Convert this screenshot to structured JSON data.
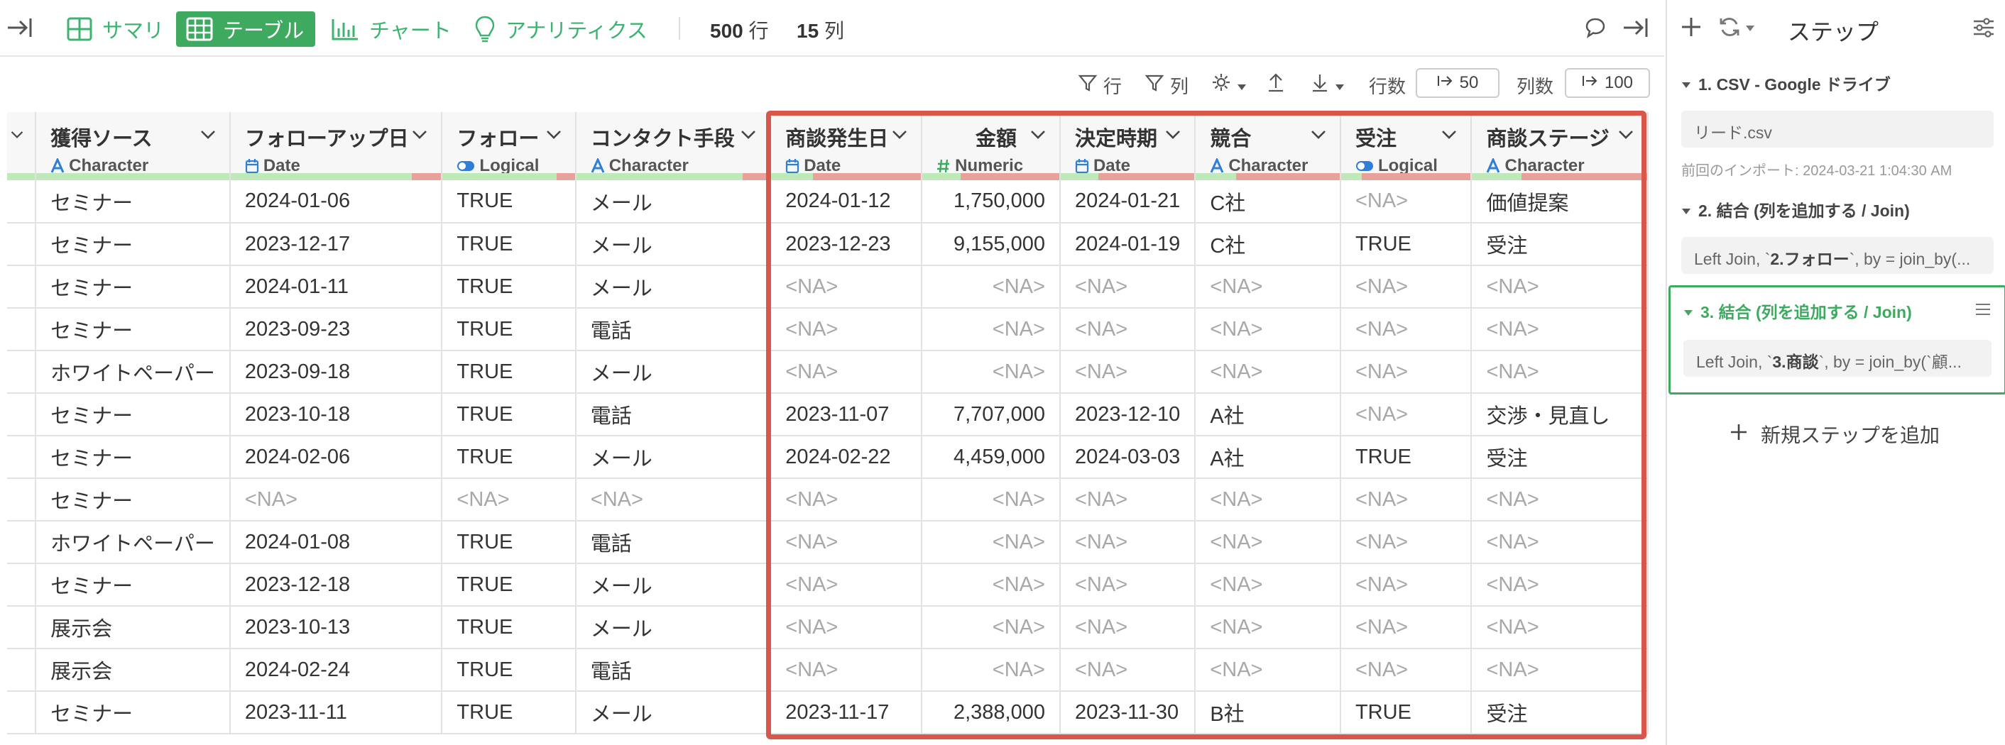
{
  "toolbar": {
    "tabs": [
      {
        "label": "サマリ",
        "icon": "summary-grid-icon"
      },
      {
        "label": "テーブル",
        "icon": "table-icon",
        "active": true
      },
      {
        "label": "チャート",
        "icon": "bar-chart-icon"
      },
      {
        "label": "アナリティクス",
        "icon": "lightbulb-icon"
      }
    ],
    "rows_count": "500",
    "rows_unit": "行",
    "cols_count": "15",
    "cols_unit": "列"
  },
  "toolbar2": {
    "filter_rows": "行",
    "filter_cols": "列",
    "row_count_label": "行数",
    "row_count_value": "50",
    "col_count_label": "列数",
    "col_count_value": "100"
  },
  "columns": [
    {
      "name": "獲得ソース",
      "type": "Character",
      "type_icon": "character-icon",
      "ok": 1.0
    },
    {
      "name": "フォローアップ日",
      "type": "Date",
      "type_icon": "calendar-icon",
      "ok": 0.86
    },
    {
      "name": "フォロー",
      "type": "Logical",
      "type_icon": "toggle-icon",
      "ok": 0.86
    },
    {
      "name": "コンタクト手段",
      "type": "Character",
      "type_icon": "character-icon",
      "ok": 0.86
    },
    {
      "name": "商談発生日",
      "type": "Date",
      "type_icon": "calendar-icon",
      "ok": 0.28
    },
    {
      "name": "金額",
      "type": "Numeric",
      "type_icon": "numeric-icon",
      "ok": 0.28
    },
    {
      "name": "決定時期",
      "type": "Date",
      "type_icon": "calendar-icon",
      "ok": 0.28
    },
    {
      "name": "競合",
      "type": "Character",
      "type_icon": "character-icon",
      "ok": 0.28
    },
    {
      "name": "受注",
      "type": "Logical",
      "type_icon": "toggle-icon",
      "ok": 0.16
    },
    {
      "name": "商談ステージ",
      "type": "Character",
      "type_icon": "character-icon",
      "ok": 0.28
    }
  ],
  "rows": [
    [
      "セミナー",
      "2024-01-06",
      "TRUE",
      "メール",
      "2024-01-12",
      "1,750,000",
      "2024-01-21",
      "C社",
      "<NA>",
      "価値提案"
    ],
    [
      "セミナー",
      "2023-12-17",
      "TRUE",
      "メール",
      "2023-12-23",
      "9,155,000",
      "2024-01-19",
      "C社",
      "TRUE",
      "受注"
    ],
    [
      "セミナー",
      "2024-01-11",
      "TRUE",
      "メール",
      "<NA>",
      "<NA>",
      "<NA>",
      "<NA>",
      "<NA>",
      "<NA>"
    ],
    [
      "セミナー",
      "2023-09-23",
      "TRUE",
      "電話",
      "<NA>",
      "<NA>",
      "<NA>",
      "<NA>",
      "<NA>",
      "<NA>"
    ],
    [
      "ホワイトペーパー",
      "2023-09-18",
      "TRUE",
      "メール",
      "<NA>",
      "<NA>",
      "<NA>",
      "<NA>",
      "<NA>",
      "<NA>"
    ],
    [
      "セミナー",
      "2023-10-18",
      "TRUE",
      "電話",
      "2023-11-07",
      "7,707,000",
      "2023-12-10",
      "A社",
      "<NA>",
      "交渉・見直し"
    ],
    [
      "セミナー",
      "2024-02-06",
      "TRUE",
      "メール",
      "2024-02-22",
      "4,459,000",
      "2024-03-03",
      "A社",
      "TRUE",
      "受注"
    ],
    [
      "セミナー",
      "<NA>",
      "<NA>",
      "<NA>",
      "<NA>",
      "<NA>",
      "<NA>",
      "<NA>",
      "<NA>",
      "<NA>"
    ],
    [
      "ホワイトペーパー",
      "2024-01-08",
      "TRUE",
      "電話",
      "<NA>",
      "<NA>",
      "<NA>",
      "<NA>",
      "<NA>",
      "<NA>"
    ],
    [
      "セミナー",
      "2023-12-18",
      "TRUE",
      "メール",
      "<NA>",
      "<NA>",
      "<NA>",
      "<NA>",
      "<NA>",
      "<NA>"
    ],
    [
      "展示会",
      "2023-10-13",
      "TRUE",
      "メール",
      "<NA>",
      "<NA>",
      "<NA>",
      "<NA>",
      "<NA>",
      "<NA>"
    ],
    [
      "展示会",
      "2024-02-24",
      "TRUE",
      "電話",
      "<NA>",
      "<NA>",
      "<NA>",
      "<NA>",
      "<NA>",
      "<NA>"
    ],
    [
      "セミナー",
      "2023-11-11",
      "TRUE",
      "メール",
      "2023-11-17",
      "2,388,000",
      "2023-11-30",
      "B社",
      "TRUE",
      "受注"
    ]
  ],
  "panel": {
    "title": "ステップ",
    "steps": [
      {
        "title": "1. CSV - Google ドライブ",
        "body": "リード.csv",
        "note": "前回のインポート: 2024-03-21 1:04:30 AM"
      },
      {
        "title": "2. 結合 (列を追加する / Join)",
        "body_prefix": "Left Join, `",
        "body_bold": "2.フォロー",
        "body_suffix": "`, by = join_by(..."
      },
      {
        "title": "3. 結合 (列を追加する / Join)",
        "body_prefix": "Left Join, `",
        "body_bold": "3.商談",
        "body_suffix": "`, by = join_by(`顧..."
      }
    ],
    "add_step": "新規ステップを追加"
  },
  "colors": {
    "accent": "#3eaa60",
    "highlight": "#d9574a",
    "na_text": "#a8a8a8"
  }
}
